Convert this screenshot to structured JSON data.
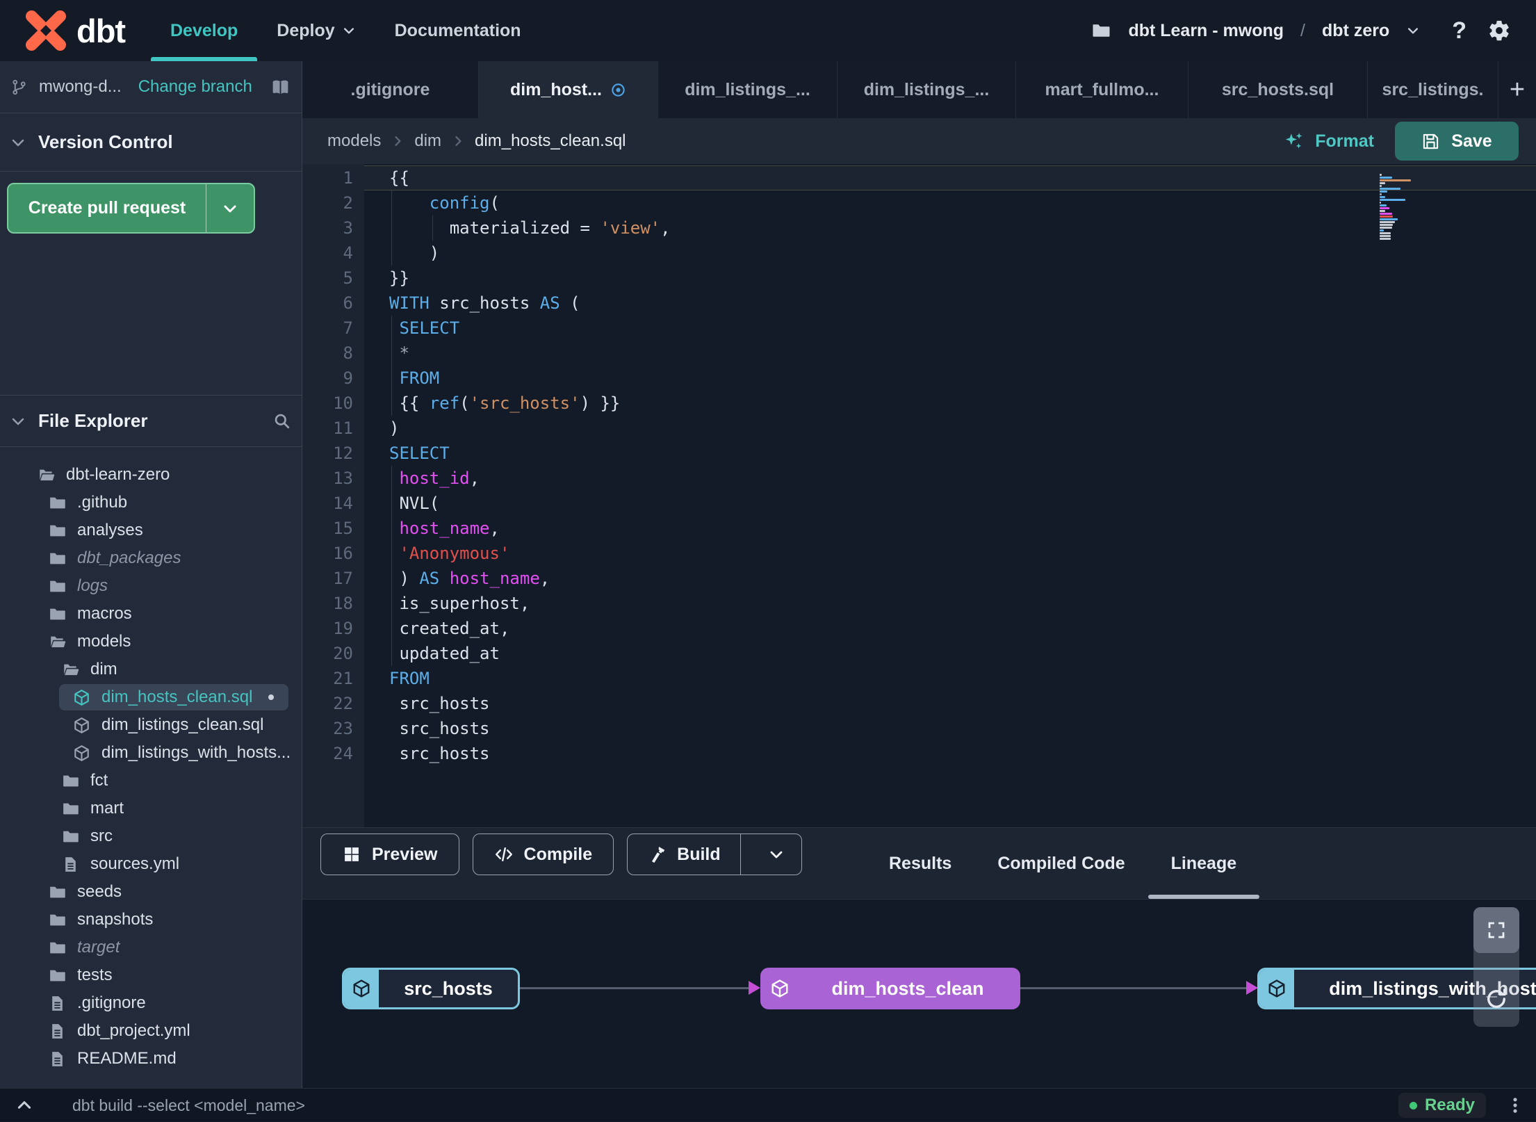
{
  "colors": {
    "accent_teal": "#45c4c0",
    "brand_orange": "#ff6849",
    "button_green": "#3f9467",
    "button_green_border": "#7ccb9f",
    "save_teal": "#2b6f68",
    "ready_green": "#41c877",
    "lineage_purple": "#aa63d4",
    "lineage_teal": "#7dc8e0",
    "tab_dirty_blue": "#4aa4e8",
    "code": {
      "keyword": "#5caee8",
      "string": "#cf9063",
      "string_red": "#e2504c",
      "identifier": "#e24ff2",
      "text": "#dce2ea",
      "muted": "#9aa4b2"
    }
  },
  "navbar": {
    "brand": "dbt",
    "nav": [
      {
        "label": "Develop",
        "active": true,
        "chevron": false
      },
      {
        "label": "Deploy",
        "active": false,
        "chevron": true
      },
      {
        "label": "Documentation",
        "active": false,
        "chevron": false
      }
    ],
    "project_selector": {
      "account": "dbt Learn - mwong",
      "separator": "/",
      "project": "dbt zero"
    },
    "help_label": "?"
  },
  "sidebar": {
    "branch": {
      "name": "mwong-d...",
      "change_branch": "Change branch"
    },
    "version_control": {
      "title": "Version Control",
      "create_pr": "Create pull request"
    },
    "file_explorer": {
      "title": "File Explorer",
      "tree": [
        {
          "label": "dbt-learn-zero",
          "icon": "folder-open",
          "level": 1
        },
        {
          "label": ".github",
          "icon": "folder",
          "level": 2
        },
        {
          "label": "analyses",
          "icon": "folder",
          "level": 2
        },
        {
          "label": "dbt_packages",
          "icon": "folder",
          "level": 2,
          "muted": true
        },
        {
          "label": "logs",
          "icon": "folder",
          "level": 2,
          "muted": true
        },
        {
          "label": "macros",
          "icon": "folder",
          "level": 2
        },
        {
          "label": "models",
          "icon": "folder-open",
          "level": 2
        },
        {
          "label": "dim",
          "icon": "folder-open",
          "level": 3
        },
        {
          "label": "dim_hosts_clean.sql",
          "icon": "model",
          "level": 4,
          "selected": true,
          "modified": true
        },
        {
          "label": "dim_listings_clean.sql",
          "icon": "model",
          "level": 4
        },
        {
          "label": "dim_listings_with_hosts...",
          "icon": "model",
          "level": 4
        },
        {
          "label": "fct",
          "icon": "folder",
          "level": 3
        },
        {
          "label": "mart",
          "icon": "folder",
          "level": 3
        },
        {
          "label": "src",
          "icon": "folder",
          "level": 3
        },
        {
          "label": "sources.yml",
          "icon": "file",
          "level": 3
        },
        {
          "label": "seeds",
          "icon": "folder",
          "level": 2
        },
        {
          "label": "snapshots",
          "icon": "folder",
          "level": 2
        },
        {
          "label": "target",
          "icon": "folder",
          "level": 2,
          "muted": true
        },
        {
          "label": "tests",
          "icon": "folder",
          "level": 2
        },
        {
          "label": ".gitignore",
          "icon": "file",
          "level": 2
        },
        {
          "label": "dbt_project.yml",
          "icon": "file",
          "level": 2
        },
        {
          "label": "README.md",
          "icon": "file",
          "level": 2
        }
      ]
    }
  },
  "tab_bar": {
    "new_tab_label": "+",
    "tabs": [
      {
        "label": ".gitignore"
      },
      {
        "label": "dim_host...",
        "active": true,
        "dirty": true
      },
      {
        "label": "dim_listings_..."
      },
      {
        "label": "dim_listings_..."
      },
      {
        "label": "mart_fullmo..."
      },
      {
        "label": "src_hosts.sql"
      },
      {
        "label": "src_listings."
      }
    ]
  },
  "editor": {
    "breadcrumb": [
      "models",
      "dim",
      "dim_hosts_clean.sql"
    ],
    "format_label": "Format",
    "save_label": "Save",
    "code_lines": [
      [
        [
          "{{",
          "w"
        ]
      ],
      [
        [
          "    ",
          "w"
        ],
        [
          "config",
          "b"
        ],
        [
          "(",
          "w"
        ]
      ],
      [
        [
          "      materialized = ",
          "w"
        ],
        [
          "'view'",
          "o"
        ],
        [
          ",",
          "w"
        ]
      ],
      [
        [
          "    )",
          "w"
        ]
      ],
      [
        [
          "}}",
          "w"
        ]
      ],
      [
        [
          "WITH",
          "b"
        ],
        [
          " src_hosts ",
          "w"
        ],
        [
          "AS",
          "b"
        ],
        [
          " (",
          "w"
        ]
      ],
      [
        [
          " ",
          "w"
        ],
        [
          "SELECT",
          "b"
        ]
      ],
      [
        [
          " ",
          "w"
        ],
        [
          "*",
          "g"
        ]
      ],
      [
        [
          " ",
          "w"
        ],
        [
          "FROM",
          "b"
        ]
      ],
      [
        [
          " {{ ",
          "w"
        ],
        [
          "ref",
          "b"
        ],
        [
          "(",
          "w"
        ],
        [
          "'src_hosts'",
          "o"
        ],
        [
          ") }}",
          "w"
        ]
      ],
      [
        [
          ")",
          "w"
        ]
      ],
      [
        [
          "SELECT",
          "b"
        ]
      ],
      [
        [
          " ",
          "w"
        ],
        [
          "host_id",
          "m"
        ],
        [
          ",",
          "w"
        ]
      ],
      [
        [
          " NVL(",
          "w"
        ]
      ],
      [
        [
          " ",
          "w"
        ],
        [
          "host_name",
          "m"
        ],
        [
          ",",
          "w"
        ]
      ],
      [
        [
          " ",
          "w"
        ],
        [
          "'Anonymous'",
          "r"
        ]
      ],
      [
        [
          " ) ",
          "w"
        ],
        [
          "AS",
          "b"
        ],
        [
          " ",
          "w"
        ],
        [
          "host_name",
          "m"
        ],
        [
          ",",
          "w"
        ]
      ],
      [
        [
          " is_superhost,",
          "w"
        ]
      ],
      [
        [
          " created_at,",
          "w"
        ]
      ],
      [
        [
          " updated_at",
          "w"
        ]
      ],
      [
        [
          "FROM",
          "b"
        ]
      ],
      [
        [
          " src_hosts",
          "w"
        ]
      ],
      [
        [
          " src_hosts",
          "w"
        ]
      ],
      [
        [
          " src_hosts",
          "w"
        ]
      ]
    ]
  },
  "bottom_panel": {
    "buttons": [
      {
        "label": "Preview",
        "icon": "grid"
      },
      {
        "label": "Compile",
        "icon": "code"
      },
      {
        "label": "Build",
        "icon": "hammer",
        "split": true
      }
    ],
    "tabs": [
      {
        "label": "Results"
      },
      {
        "label": "Compiled Code"
      },
      {
        "label": "Lineage",
        "active": true
      }
    ]
  },
  "lineage": {
    "nodes": [
      {
        "label": "src_hosts",
        "style": "teal"
      },
      {
        "label": "dim_hosts_clean",
        "style": "purple"
      },
      {
        "label": "dim_listings_with_hosts",
        "style": "teal"
      }
    ]
  },
  "status_bar": {
    "command": "dbt build --select <model_name>",
    "status": "Ready"
  }
}
